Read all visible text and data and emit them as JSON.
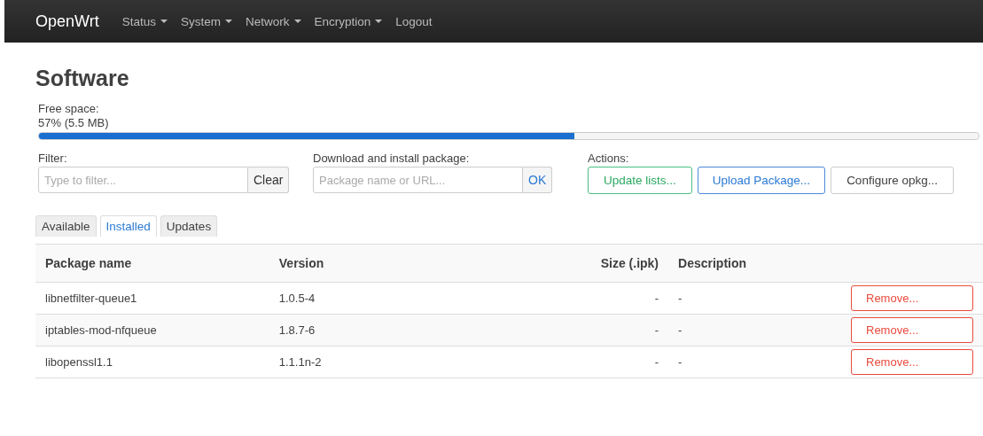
{
  "navbar": {
    "brand": "OpenWrt",
    "menus": [
      {
        "label": "Status",
        "dropdown": true
      },
      {
        "label": "System",
        "dropdown": true
      },
      {
        "label": "Network",
        "dropdown": true
      },
      {
        "label": "Encryption",
        "dropdown": true
      },
      {
        "label": "Logout",
        "dropdown": false
      }
    ]
  },
  "title": "Software",
  "free_space": {
    "label": "Free space:",
    "reading": "57% (5.5 MB)",
    "level": 0.57
  },
  "filter": {
    "label": "Filter:",
    "placeholder": "Type to filter...",
    "button": "Clear"
  },
  "install": {
    "label": "Download and install package:",
    "placeholder": "Package name or URL...",
    "button": "OK"
  },
  "actions": {
    "label": "Actions:",
    "buttons": [
      {
        "label": "Update lists...",
        "kind": "positive"
      },
      {
        "label": "Upload Package...",
        "kind": "action"
      },
      {
        "label": "Configure opkg...",
        "kind": "neutral"
      }
    ]
  },
  "tabs": [
    {
      "label": "Available",
      "selected": false
    },
    {
      "label": "Installed",
      "selected": true
    },
    {
      "label": "Updates",
      "selected": false
    }
  ],
  "table": {
    "columns": [
      "Package name",
      "Version",
      "Size (.ipk)",
      "Description"
    ],
    "rows": [
      {
        "name": "libnetfilter-queue1",
        "version": "1.0.5-4",
        "size": "-",
        "description": "-",
        "button": "Remove..."
      },
      {
        "name": "iptables-mod-nfqueue",
        "version": "1.8.7-6",
        "size": "-",
        "description": "-",
        "button": "Remove..."
      },
      {
        "name": "libopenssl1.1",
        "version": "1.1.1n-2",
        "size": "-",
        "description": "-",
        "button": "Remove..."
      }
    ]
  }
}
